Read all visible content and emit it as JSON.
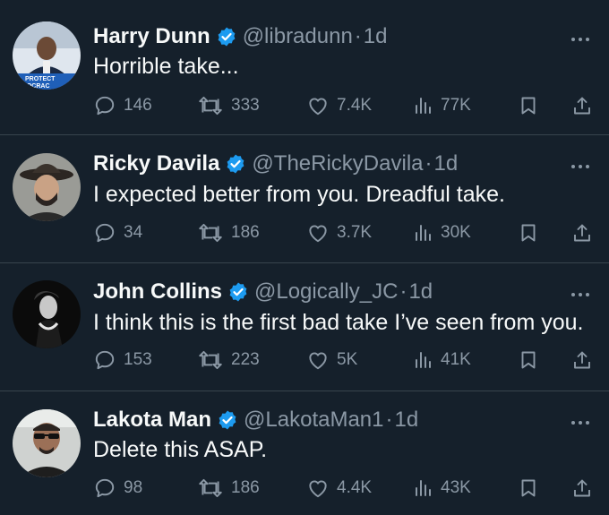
{
  "tweets": [
    {
      "name": "Harry Dunn",
      "handle": "@libradunn",
      "separator": "·",
      "time": "1d",
      "text": "Horrible take...",
      "replies": "146",
      "retweets": "333",
      "likes": "7.4K",
      "views": "77K",
      "avatar_sign_text": "PROTECT\nMOCRAC"
    },
    {
      "name": "Ricky Davila",
      "handle": "@TheRickyDavila",
      "separator": "·",
      "time": "1d",
      "text": "I expected better from you. Dreadful take.",
      "replies": "34",
      "retweets": "186",
      "likes": "3.7K",
      "views": "30K"
    },
    {
      "name": "John Collins",
      "handle": "@Logically_JC",
      "separator": "·",
      "time": "1d",
      "text": "I think this is the first bad take I’ve seen from you.",
      "replies": "153",
      "retweets": "223",
      "likes": "5K",
      "views": "41K"
    },
    {
      "name": "Lakota Man",
      "handle": "@LakotaMan1",
      "separator": "·",
      "time": "1d",
      "text": "Delete this ASAP.",
      "replies": "98",
      "retweets": "186",
      "likes": "4.4K",
      "views": "43K"
    }
  ],
  "colors": {
    "background": "#15202b",
    "divider": "#38444d",
    "text_primary": "#f7f9f9",
    "text_secondary": "#8b98a5",
    "verified_badge": "#1d9bf0"
  },
  "icons": [
    "verified-badge-icon",
    "more-options-icon",
    "reply-icon",
    "retweet-icon",
    "like-icon",
    "views-icon",
    "bookmark-icon",
    "share-icon"
  ]
}
